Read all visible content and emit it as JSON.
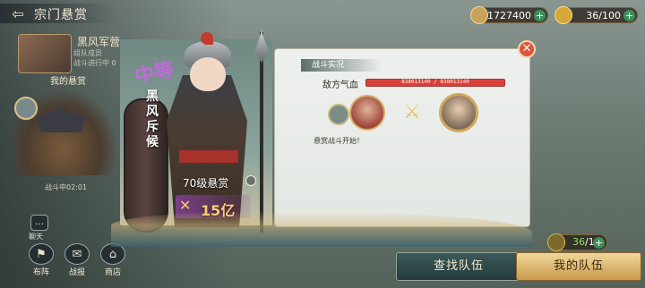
{
  "header": {
    "back_label": "⇦",
    "title": "宗门悬赏"
  },
  "resources": {
    "silver": {
      "value": "1727400",
      "plus": "+",
      "icon": "silver-ingot-icon",
      "color": "#c9a15a"
    },
    "gold": {
      "value": "36/100",
      "plus": "+",
      "icon": "gold-coin-icon",
      "color": "#d8a73a"
    }
  },
  "sidebar": {
    "bounty_name": "黑风军营",
    "bounty_sub_1": "组队成员",
    "bounty_sub_2": "战斗进行中 0",
    "my_bounty_label": "我的悬赏",
    "fight_time": "战斗中02:01",
    "chat_label": "聊天",
    "chat_icon": "…",
    "bottom_items": [
      {
        "label": "布阵",
        "icon": "formation-icon",
        "glyph": "⚑"
      },
      {
        "label": "战报",
        "icon": "report-icon",
        "glyph": "✉"
      },
      {
        "label": "商店",
        "icon": "shop-icon",
        "glyph": "⌂"
      }
    ]
  },
  "character": {
    "rarity": "中等",
    "name_chars": [
      "黑",
      "风",
      "斥",
      "候"
    ],
    "level_label": "70级悬赏",
    "reward_value": "15亿",
    "reward_icon": "✕"
  },
  "battle_panel": {
    "header": "战斗实况",
    "close_label": "✕",
    "enemy_hp_label": "敌方气血",
    "enemy_hp_text": "838013140 / 838013140",
    "enemy_hp_fraction": 1.0,
    "vs_glyph": "⚔",
    "log_line": "悬赏战斗开始！"
  },
  "team": {
    "count_current": "36",
    "count_total": "/10",
    "plus": "+",
    "find_team_label": "查找队伍",
    "my_team_label": "我的队伍"
  }
}
